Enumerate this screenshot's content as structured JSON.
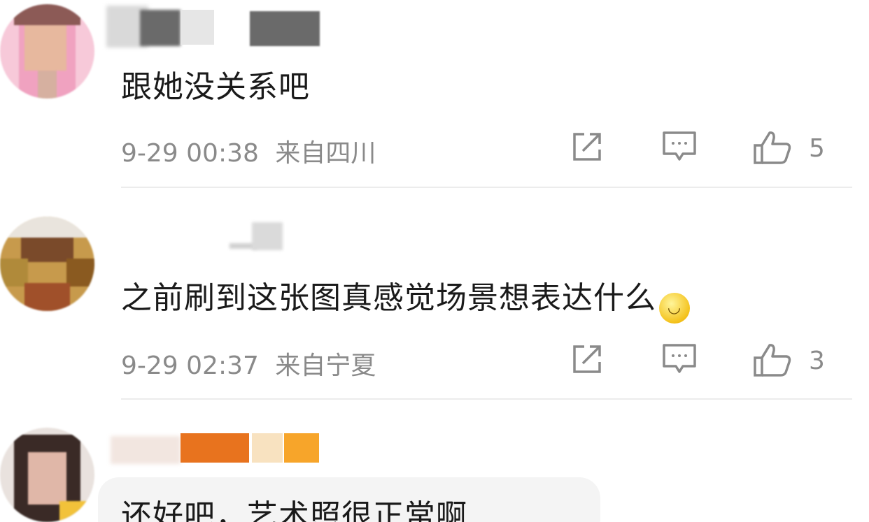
{
  "comments": [
    {
      "text": "跟她没关系吧",
      "time": "9-29 00:38",
      "location": "来自四川",
      "likes": "5"
    },
    {
      "text": "之前刷到这张图真感觉场景想表达什么",
      "emoji": "smile-emoji",
      "time": "9-29 02:37",
      "location": "来自宁夏",
      "likes": "3"
    },
    {
      "text": "还好吧，艺术照很正常啊"
    }
  ],
  "colors": {
    "meta_text": "#8a8a8a",
    "body_text": "#1a1a1a",
    "divider": "#ececec"
  },
  "icons": [
    "share-icon",
    "comment-icon",
    "like-icon",
    "smile-emoji"
  ]
}
